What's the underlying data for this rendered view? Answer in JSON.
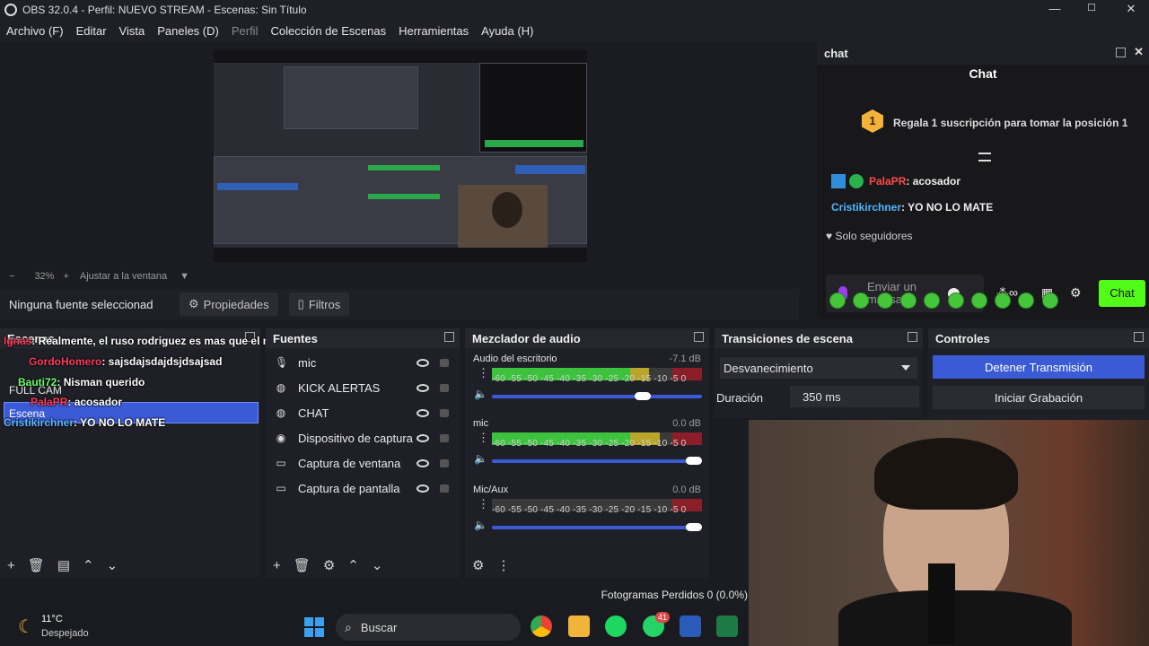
{
  "window": {
    "title": "OBS 32.0.4 - Perfil: NUEVO STREAM - Escenas: Sin Título",
    "minimize": "—",
    "maximize": "☐",
    "close": "✕"
  },
  "menu": [
    "Archivo (F)",
    "Editar",
    "Vista",
    "Paneles (D)",
    "Perfil",
    "Colección de Escenas",
    "Herramientas",
    "Ayuda (H)"
  ],
  "zoom": {
    "minus": "−",
    "value": "32%",
    "plus": "+",
    "fit": "Ajustar a la ventana"
  },
  "source_toolbar": {
    "no_source": "Ninguna fuente seleccionad",
    "properties": "Propiedades",
    "filters": "Filtros"
  },
  "scenes": {
    "title": "Escenas",
    "items": [
      "FULL CAM",
      "Escena"
    ],
    "chat_overlay": [
      {
        "user": "Ignas",
        "msg": ": Realmente, el ruso rodriguez es mas que el marquito"
      },
      {
        "user": "GordoHomero",
        "msg": ": sajsdajsdajdsjdsajsad"
      },
      {
        "user": "Bauti72",
        "msg": ": Nisman querido"
      },
      {
        "user": "PalaPR",
        "msg": ": acosador"
      },
      {
        "user": "Cristikirchner",
        "msg": ": YO NO LO MATE"
      }
    ]
  },
  "sources": {
    "title": "Fuentes",
    "items": [
      "mic",
      "KICK ALERTAS",
      "CHAT",
      "Dispositivo de captura d",
      "Captura de ventana",
      "Captura de pantalla"
    ]
  },
  "mixer": {
    "title": "Mezclador de audio",
    "channels": [
      {
        "name": "Audio del escritorio",
        "db": "-7.1 dB",
        "level": 0.75,
        "volume": 0.72
      },
      {
        "name": "mic",
        "db": "0.0 dB",
        "level": 0.8,
        "volume": 0.96
      },
      {
        "name": "Mic/Aux",
        "db": "0.0 dB",
        "level": 0.0,
        "volume": 0.96
      }
    ],
    "ticks": "-60 -55 -50 -45 -40 -35 -30 -25 -20 -15 -10 -5 0"
  },
  "transitions": {
    "title": "Transiciones de escena",
    "selected": "Desvanecimiento",
    "duration_label": "Duración",
    "duration_value": "350 ms"
  },
  "controls": {
    "title": "Controles",
    "stop_stream": "Detener Transmisión",
    "start_record": "Iniciar Grabación"
  },
  "status": {
    "dropped": "Fotogramas Perdidos 0 (0.0%)"
  },
  "taskbar": {
    "temp": "11°C",
    "weather": "Despejado",
    "search": "Buscar",
    "badge": "41"
  },
  "chat": {
    "dock_title": "chat",
    "header": "Chat",
    "gift_rank": "1",
    "gift_text": "Regala 1 suscripción para tomar la posición 1",
    "messages": [
      {
        "user": "PalaPR",
        "text": ": acosador"
      },
      {
        "user": "Cristikirchner",
        "text": ": YO NO LO MATE"
      }
    ],
    "followers_only": "Solo seguidores",
    "input_placeholder": "Enviar un mensaje",
    "chat_button": "Chat"
  },
  "colors": {
    "accent": "#3b5bd6",
    "kick_green": "#53fc18",
    "bg": "#1b1c22"
  }
}
